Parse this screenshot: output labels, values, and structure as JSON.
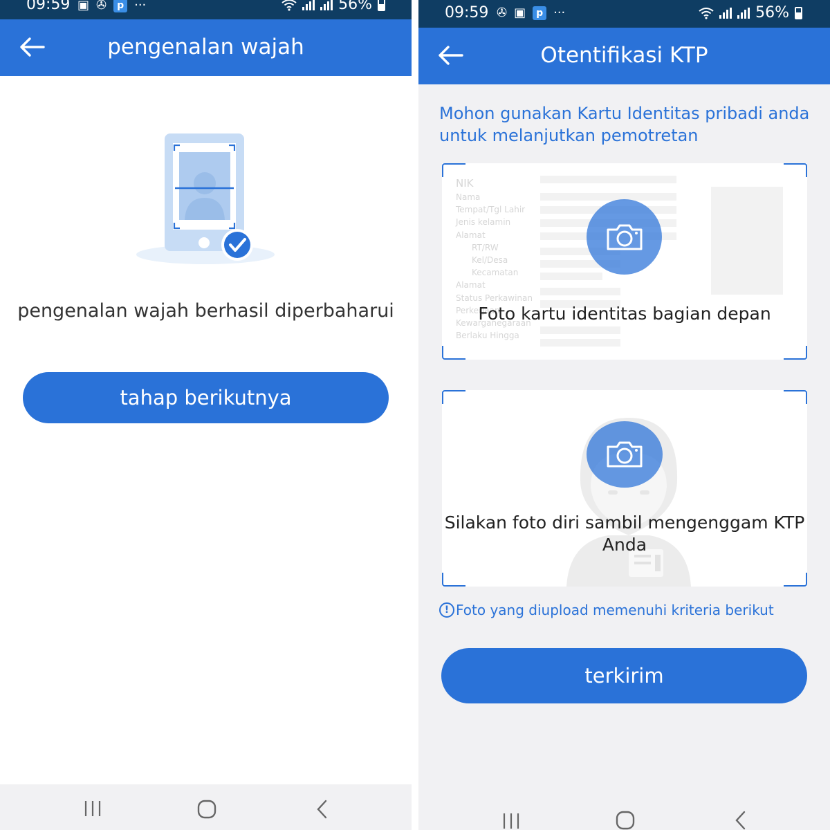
{
  "left_screen": {
    "status_bar": {
      "time": "09:59",
      "more": "···",
      "battery": "56%"
    },
    "app_bar": {
      "title": "pengenalan wajah"
    },
    "message": "pengenalan wajah berhasil diperbaharui",
    "next_button": "tahap berikutnya"
  },
  "right_screen": {
    "status_bar": {
      "time": "09:59",
      "more": "···",
      "battery": "56%"
    },
    "app_bar": {
      "title": "Otentifikasi KTP"
    },
    "instruction": "Mohon gunakan Kartu Identitas pribadi anda untuk melanjutkan pemotretan",
    "front_card": {
      "caption": "Foto kartu identitas bagian depan",
      "ktp_fields": [
        "NIK",
        "Nama",
        "Tempat/Tgl Lahir",
        "Jenis kelamin",
        "Alamat",
        "RT/RW",
        "Kel/Desa",
        "Kecamatan",
        "Alamat",
        "Status Perkawinan",
        "Perkerjaan",
        "Kewarganegaraan",
        "Berlaku Hingga"
      ]
    },
    "selfie_card": {
      "caption": "Silakan foto diri sambil mengenggam KTP Anda"
    },
    "hint": "Foto yang diupload memenuhi kriteria berikut",
    "hint_icon": "!",
    "submit_button": "terkirim"
  },
  "colors": {
    "primary": "#2a72d8",
    "status_bar": "#0f3d63",
    "background_right": "#f1f1f3"
  },
  "icons": [
    "back-arrow-icon",
    "camera-icon",
    "phone-face-scan-icon",
    "check-badge-icon",
    "recent-apps-icon",
    "home-icon",
    "nav-back-icon",
    "wifi-icon",
    "signal-icon",
    "battery-icon"
  ]
}
